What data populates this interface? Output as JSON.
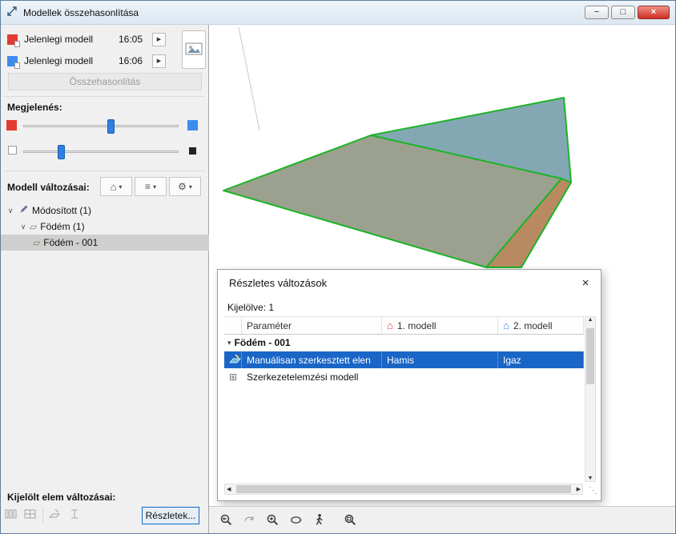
{
  "window": {
    "title": "Modellek összehasonlítása",
    "minimize": "−",
    "maximize": "□",
    "close": "×"
  },
  "sidebar": {
    "models": [
      {
        "name": "Jelenlegi modell",
        "time": "16:05"
      },
      {
        "name": "Jelenlegi modell",
        "time": "16:06"
      }
    ],
    "compare_button": "Összehasonlítás",
    "appearance_label": "Megjelenés:",
    "model_changes_label": "Modell változásai:",
    "tree": [
      {
        "label": "Módosított (1)"
      },
      {
        "label": "Födém (1)"
      },
      {
        "label": "Födém - 001"
      }
    ],
    "selected_element_label": "Kijelölt elem változásai:",
    "details_button": "Részletek..."
  },
  "overlay": {
    "title": "Részletes változások",
    "close": "×",
    "selected_count": "Kijelölve: 1",
    "columns": {
      "param": "Paraméter",
      "model1": "1. modell",
      "model2": "2. modell"
    },
    "group": "Födém - 001",
    "rows": [
      {
        "param": "Manuálisan szerkesztett elen",
        "model1": "Hamis",
        "model2": "Igaz"
      },
      {
        "param": "Szerkezetelemzési modell",
        "model1": "",
        "model2": ""
      }
    ]
  },
  "colors": {
    "model1_red": "#e23c32",
    "model2_blue": "#3c8cf0",
    "selection_blue": "#1a66c7",
    "edge_green": "#1cb426",
    "slab_top": "#9ba18e",
    "slab_teal": "#83a8b4",
    "slab_side": "#b98a62",
    "faint_line": "#c9c9c9"
  },
  "glyphs": {
    "chevron": "∨",
    "dropdown": "▾",
    "play": "▶",
    "house": "⌂",
    "slab": "▱",
    "pencil_list": "≡",
    "gear": "⚙",
    "group_collapse": "▾",
    "up": "▲",
    "down": "▼",
    "left": "◀",
    "right": "▶",
    "grip": "⋱",
    "frame": "⊞"
  }
}
